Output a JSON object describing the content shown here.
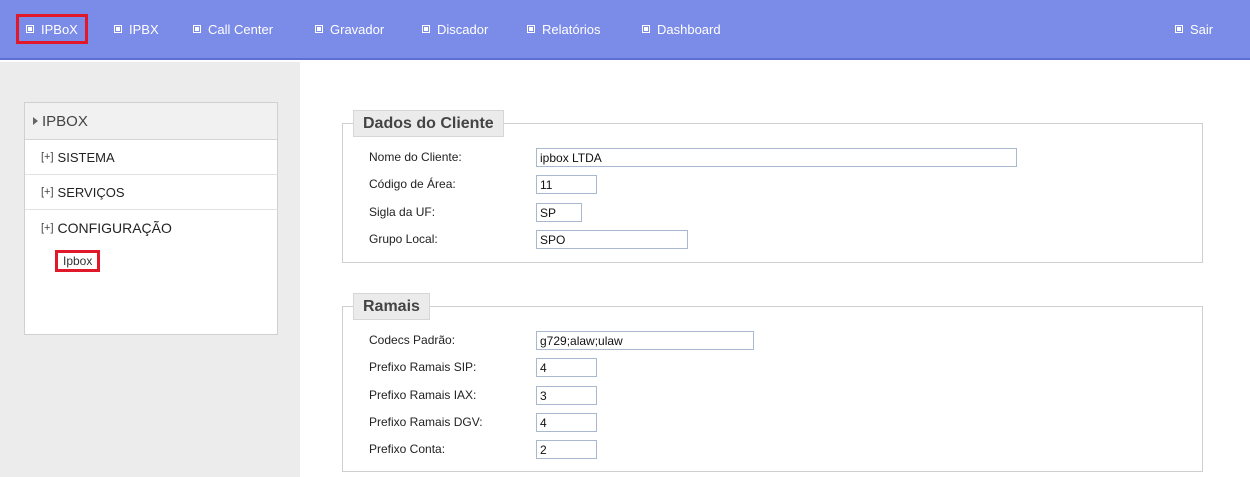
{
  "nav": {
    "items": [
      {
        "label": "IPBoX"
      },
      {
        "label": "IPBX"
      },
      {
        "label": "Call Center"
      },
      {
        "label": "Gravador"
      },
      {
        "label": "Discador"
      },
      {
        "label": "Relatórios"
      },
      {
        "label": "Dashboard"
      }
    ],
    "logout": "Sair",
    "active": "IPBoX"
  },
  "sidebar": {
    "title": "IPBOX",
    "items": [
      {
        "expander": "[+]",
        "label": "SISTEMA"
      },
      {
        "expander": "[+]",
        "label": "SERVIÇOS"
      },
      {
        "expander": "[+]",
        "label": "CONFIGURAÇÃO"
      }
    ],
    "sub_item": "Ipbox"
  },
  "client": {
    "legend": "Dados do Cliente",
    "fields": [
      {
        "label": "Nome do Cliente:",
        "value": "ipbox LTDA"
      },
      {
        "label": "Código de Área:",
        "value": "11"
      },
      {
        "label": "Sigla da UF:",
        "value": "SP"
      },
      {
        "label": "Grupo Local:",
        "value": "SPO"
      }
    ]
  },
  "ramais": {
    "legend": "Ramais",
    "fields": [
      {
        "label": "Codecs Padrão:",
        "value": "g729;alaw;ulaw"
      },
      {
        "label": "Prefixo Ramais SIP:",
        "value": "4"
      },
      {
        "label": "Prefixo Ramais IAX:",
        "value": "3"
      },
      {
        "label": "Prefixo Ramais DGV:",
        "value": "4"
      },
      {
        "label": "Prefixo Conta:",
        "value": "2"
      }
    ]
  },
  "colors": {
    "topbar": "#7b8be8",
    "highlight": "#e0182a",
    "sidebar_bg": "#ececec"
  }
}
